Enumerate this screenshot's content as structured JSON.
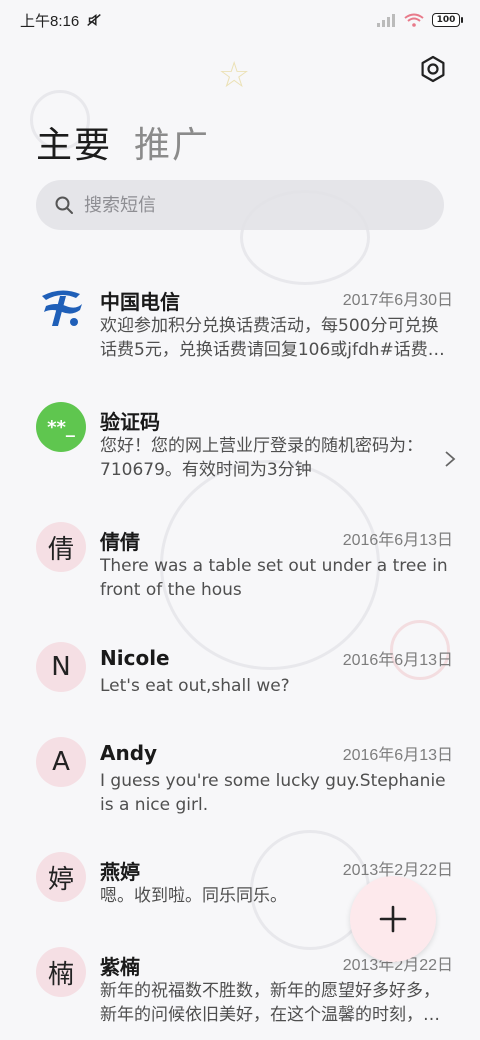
{
  "status_bar": {
    "time": "上午8:16",
    "battery": "100"
  },
  "tabs": [
    {
      "label": "主要",
      "active": true
    },
    {
      "label": "推广",
      "active": false
    }
  ],
  "search": {
    "placeholder": "搜索短信"
  },
  "conversations": [
    {
      "name": "中国电信",
      "date": "2017年6月30日",
      "preview": "欢迎参加积分兑换话费活动，每500分可兑换话费5元，兑换话费请回复106或jfdh#话费…",
      "avatar": "telecom-logo",
      "avatar_text": ""
    },
    {
      "name": "验证码",
      "date": "",
      "preview": "您好！您的网上营业厅登录的随机密码为：710679。有效时间为3分钟",
      "avatar": "green",
      "avatar_text": "**_"
    },
    {
      "name": "倩倩",
      "date": "2016年6月13日",
      "preview": "There was a table set out under a tree in front of the hous",
      "avatar": "pink",
      "avatar_text": "倩"
    },
    {
      "name": "Nicole",
      "date": "2016年6月13日",
      "preview": "Let's eat out,shall we?",
      "avatar": "pink",
      "avatar_text": "N"
    },
    {
      "name": "Andy",
      "date": "2016年6月13日",
      "preview": "I guess you're some lucky guy.Stephanie is a nice girl.",
      "avatar": "pink",
      "avatar_text": "A"
    },
    {
      "name": "燕婷",
      "date": "2013年2月22日",
      "preview": "嗯。收到啦。同乐同乐。",
      "avatar": "pink",
      "avatar_text": "婷"
    },
    {
      "name": "紫楠",
      "date": "2013年2月22日",
      "preview": "新年的祝福数不胜数，新年的愿望好多好多，新年的问候依旧美好，在这个温馨的时刻，…",
      "avatar": "pink",
      "avatar_text": "楠"
    }
  ],
  "colors": {
    "accent_pink": "#f5dfe4",
    "verify_green": "#5fc64f",
    "telecom_blue": "#1f5fb8"
  }
}
